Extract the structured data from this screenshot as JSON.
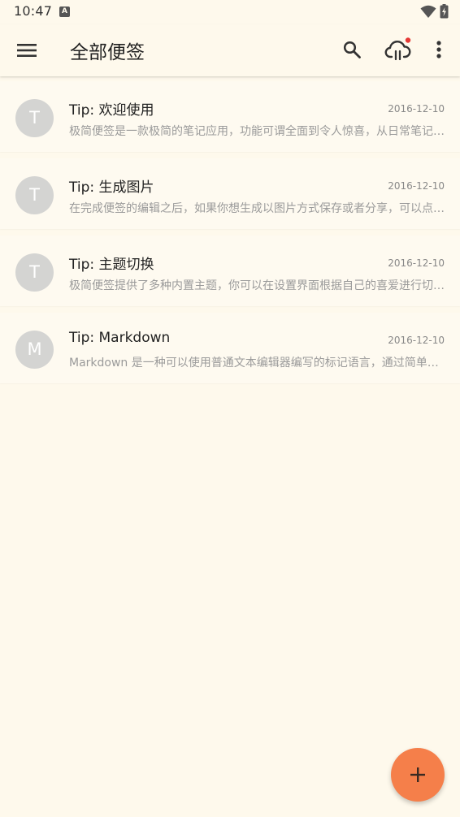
{
  "status_bar": {
    "time": "10:47",
    "notification_icon": "a-icon"
  },
  "app_bar": {
    "title": "全部便签",
    "icons": [
      "menu-icon",
      "search-icon",
      "cloud-sync-icon",
      "more-vert-icon"
    ]
  },
  "notes": [
    {
      "avatar": "T",
      "title": "Tip: 欢迎使用",
      "date": "2016-12-10",
      "preview": "极简便签是一款极简的笔记应用，功能可谓全面到令人惊喜，从日常笔记到待办清单"
    },
    {
      "avatar": "T",
      "title": "Tip: 生成图片",
      "date": "2016-12-10",
      "preview": "在完成便签的编辑之后，如果你想生成以图片方式保存或者分享，可以点击菜单"
    },
    {
      "avatar": "T",
      "title": "Tip: 主题切换",
      "date": "2016-12-10",
      "preview": "极简便签提供了多种内置主题，你可以在设置界面根据自己的喜爱进行切换选择"
    },
    {
      "avatar": "M",
      "title": "Tip: Markdown",
      "date": "2016-12-10",
      "preview": "Markdown 是一种可以使用普通文本编辑器编写的标记语言，通过简单的标记语法"
    }
  ],
  "fab": {
    "icon": "plus-icon",
    "color": "#f57f4a"
  },
  "colors": {
    "background": "#fef9ec",
    "avatar": "#d4d4d2",
    "accent": "#f57f4a",
    "sync_badge": "#e53935"
  }
}
